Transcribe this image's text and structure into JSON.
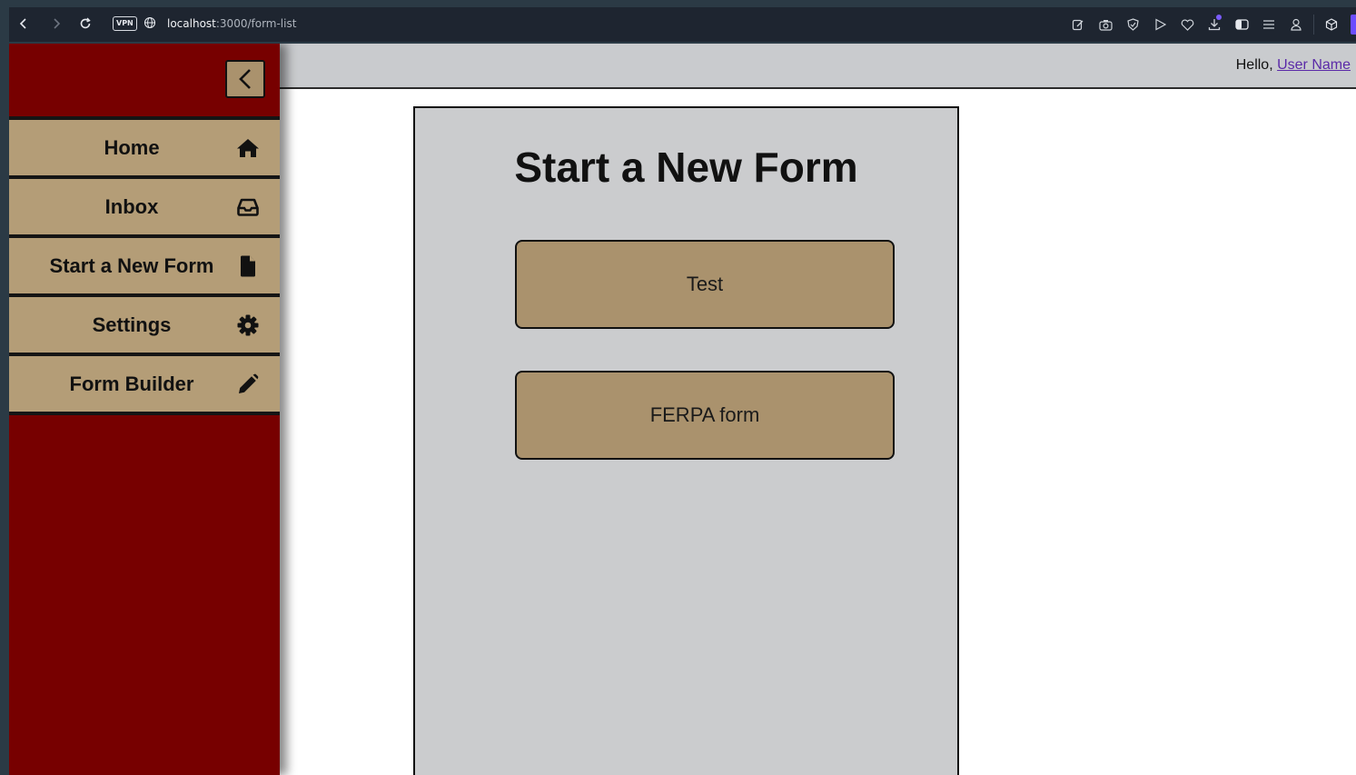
{
  "browser": {
    "vpn_label": "VPN",
    "url_host": "localhost",
    "url_path": ":3000/form-list"
  },
  "header": {
    "greeting": "Hello,",
    "user_name": "User Name"
  },
  "sidebar": {
    "items": [
      {
        "label": "Home",
        "icon": "home-icon"
      },
      {
        "label": "Inbox",
        "icon": "inbox-icon"
      },
      {
        "label": "Start a New Form",
        "icon": "file-icon"
      },
      {
        "label": "Settings",
        "icon": "gear-icon"
      },
      {
        "label": "Form Builder",
        "icon": "pencil-icon"
      }
    ]
  },
  "main": {
    "title": "Start a New Form",
    "forms": [
      {
        "label": "Test"
      },
      {
        "label": "FERPA form"
      }
    ]
  },
  "colors": {
    "sidebar_bg": "#770000",
    "menu_item_bg": "#b49d77",
    "form_button_bg": "#aa926d",
    "card_bg": "#cbccce",
    "topbar_bg": "#c9cbce",
    "link": "#5b2aa8"
  }
}
